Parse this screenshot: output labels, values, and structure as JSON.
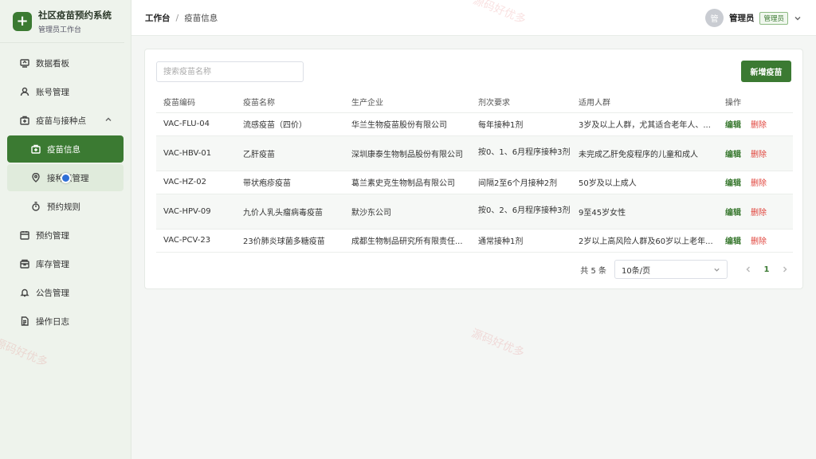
{
  "brand": {
    "title": "社区疫苗预约系统",
    "subtitle": "管理员工作台",
    "logo_glyph": "+"
  },
  "sidebar": {
    "items": [
      {
        "label": "数据看板",
        "icon": "dashboard-icon"
      },
      {
        "label": "账号管理",
        "icon": "user-icon"
      },
      {
        "label": "疫苗与接种点",
        "icon": "medkit-icon",
        "expanded": true
      },
      {
        "label": "疫苗信息",
        "icon": "medkit-icon",
        "active": true
      },
      {
        "label": "接种点管理",
        "icon": "location-pin-icon"
      },
      {
        "label": "预约规则",
        "icon": "timer-icon"
      },
      {
        "label": "预约管理",
        "icon": "calendar-icon"
      },
      {
        "label": "库存管理",
        "icon": "box-icon"
      },
      {
        "label": "公告管理",
        "icon": "bell-icon"
      },
      {
        "label": "操作日志",
        "icon": "document-icon"
      }
    ]
  },
  "header": {
    "breadcrumb_root": "工作台",
    "breadcrumb_sep": "/",
    "breadcrumb_current": "疫苗信息",
    "avatar_glyph": "管",
    "user_name": "管理员",
    "role_badge": "管理员"
  },
  "toolbar": {
    "search_placeholder": "搜索疫苗名称",
    "add_label": "新增疫苗"
  },
  "table": {
    "columns": [
      "疫苗编码",
      "疫苗名称",
      "生产企业",
      "剂次要求",
      "适用人群",
      "操作"
    ],
    "rows": [
      {
        "code": "VAC-FLU-04",
        "name": "流感疫苗（四价）",
        "maker": "华兰生物疫苗股份有限公司",
        "dose": "每年接种1剂",
        "people": "3岁及以上人群，尤其适合老年人、..."
      },
      {
        "code": "VAC-HBV-01",
        "name": "乙肝疫苗",
        "maker": "深圳康泰生物制品股份有限公司",
        "dose": "按0、1、6月程序接种3剂",
        "people": "未完成乙肝免疫程序的儿童和成人"
      },
      {
        "code": "VAC-HZ-02",
        "name": "带状疱疹疫苗",
        "maker": "葛兰素史克生物制品有限公司",
        "dose": "间隔2至6个月接种2剂",
        "people": "50岁及以上成人"
      },
      {
        "code": "VAC-HPV-09",
        "name": "九价人乳头瘤病毒疫苗",
        "maker": "默沙东公司",
        "dose": "按0、2、6月程序接种3剂",
        "people": "9至45岁女性"
      },
      {
        "code": "VAC-PCV-23",
        "name": "23价肺炎球菌多糖疫苗",
        "maker": "成都生物制品研究所有限责任...",
        "dose": "通常接种1剂",
        "people": "2岁以上高风险人群及60岁以上老年..."
      }
    ],
    "edit_label": "编辑",
    "delete_label": "删除"
  },
  "pagination": {
    "total": "共 5 条",
    "page_size": "10条/页",
    "current_page": "1"
  },
  "watermark": "源码好优多",
  "colors": {
    "accent": "#3b7a32",
    "danger": "#e0443c"
  }
}
